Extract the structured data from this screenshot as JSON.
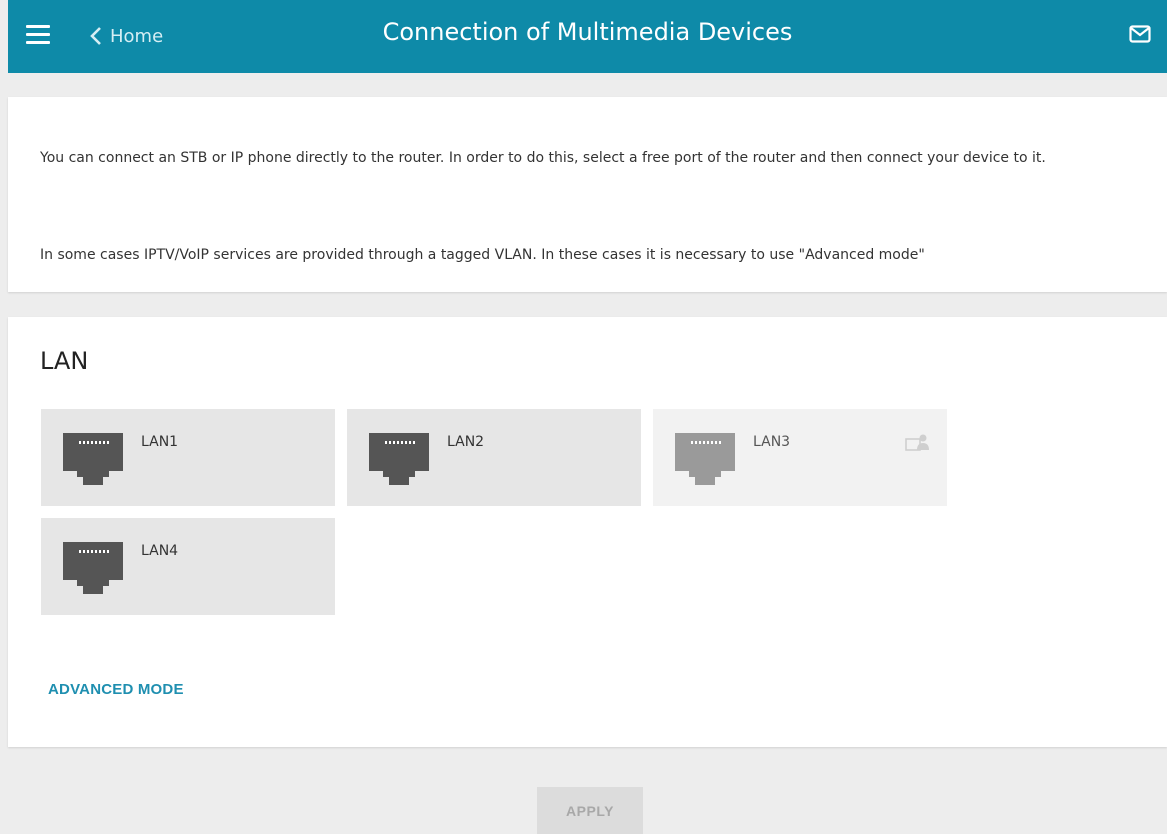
{
  "header": {
    "back_label": "Home",
    "title": "Connection of Multimedia Devices",
    "icons": [
      "menu-icon",
      "chevron-left-icon",
      "mail-icon"
    ]
  },
  "info": {
    "paragraph1": "You can connect an STB or IP phone directly to the router. In order to do this, select a free port of the router and then connect your device to it.",
    "paragraph2": "In some cases IPTV/VoIP services are provided through a tagged VLAN. In these cases it is necessary to use \"Advanced mode\""
  },
  "lan": {
    "title": "LAN",
    "ports": [
      {
        "label": "LAN1",
        "state": "available"
      },
      {
        "label": "LAN2",
        "state": "available"
      },
      {
        "label": "LAN3",
        "state": "disabled"
      },
      {
        "label": "LAN4",
        "state": "available"
      }
    ],
    "advanced_mode_label": "ADVANCED MODE"
  },
  "footer": {
    "apply_label": "APPLY"
  },
  "colors": {
    "header_bg": "#0e8aa8",
    "link": "#1f8fb0",
    "port_bg": "#e6e6e6",
    "port_icon": "#555555",
    "port_icon_disabled": "#9a9a9a"
  }
}
